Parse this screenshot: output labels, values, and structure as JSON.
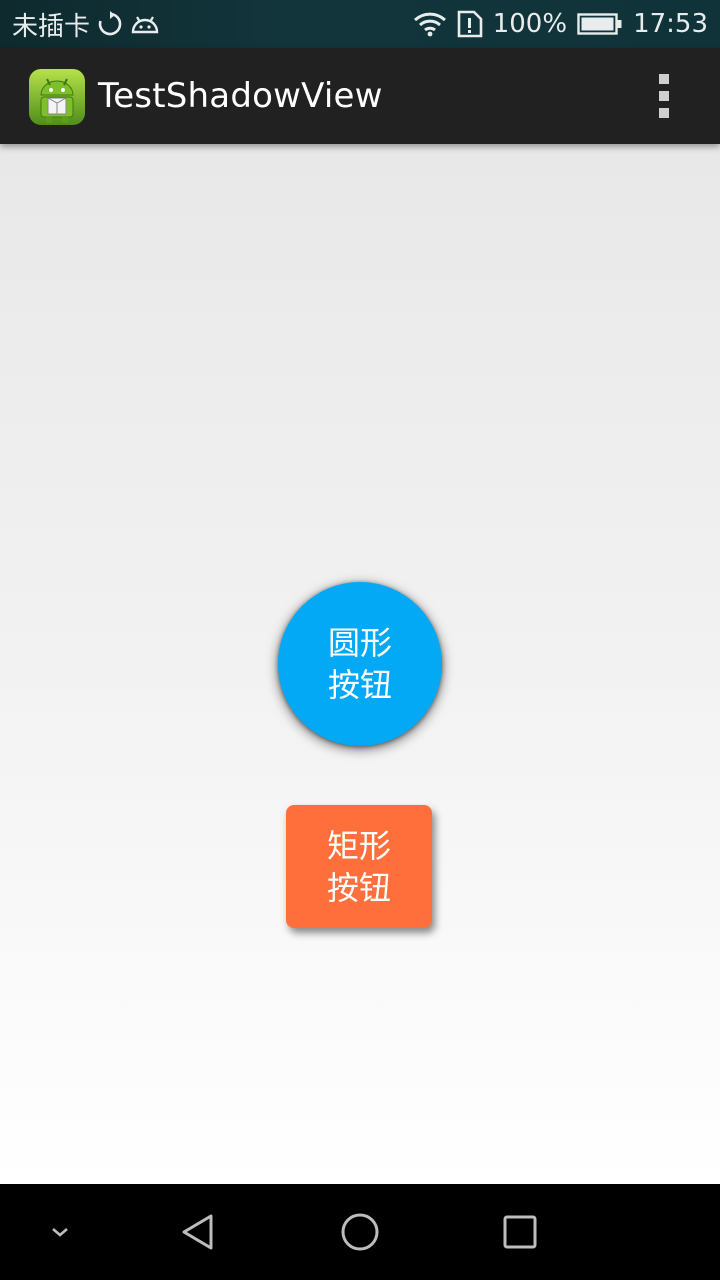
{
  "status_bar": {
    "carrier": "未插卡",
    "battery": "100%",
    "time": "17:53",
    "icons": [
      "sync-icon",
      "android-debug-icon",
      "wifi-icon",
      "sim-alert-icon",
      "battery-icon"
    ]
  },
  "action_bar": {
    "title": "TestShadowView",
    "app_icon": "android-app-icon",
    "menu_icon": "overflow-menu-icon"
  },
  "buttons": {
    "circle": {
      "line1": "圆形",
      "line2": "按钮",
      "color": "#03a9f4"
    },
    "rect": {
      "line1": "矩形",
      "line2": "按钮",
      "color": "#ff6f3c"
    }
  },
  "nav_bar": {
    "icons": [
      "hide-nav-icon",
      "back-icon",
      "home-icon",
      "recents-icon"
    ]
  }
}
